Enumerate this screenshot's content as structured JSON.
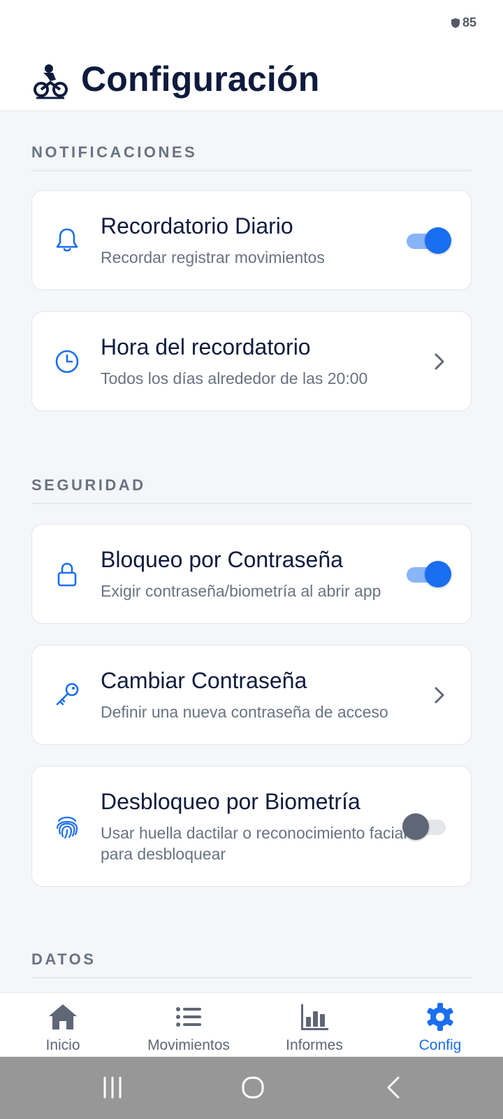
{
  "status_bar": {
    "battery": "85"
  },
  "header": {
    "title": "Configuración",
    "logo_icon": "motorcycle-rider-icon"
  },
  "sections": {
    "notifications": {
      "title": "NOTIFICACIONES",
      "items": [
        {
          "title": "Recordatorio Diario",
          "subtitle": "Recordar registrar movimientos",
          "icon": "bell-icon",
          "toggle": true
        },
        {
          "title": "Hora del recordatorio",
          "subtitle": "Todos los días alrededor de las 20:00",
          "icon": "clock-icon"
        }
      ]
    },
    "security": {
      "title": "SEGURIDAD",
      "items": [
        {
          "title": "Bloqueo por Contraseña",
          "subtitle": "Exigir contraseña/biometría al abrir app",
          "icon": "lock-icon",
          "toggle": true
        },
        {
          "title": "Cambiar Contraseña",
          "subtitle": "Definir una nueva contraseña de acceso",
          "icon": "key-icon"
        },
        {
          "title": "Desbloqueo por Biometría",
          "subtitle": "Usar huella dactilar o reconocimiento facial para desbloquear",
          "icon": "fingerprint-icon",
          "toggle": false
        }
      ]
    },
    "data": {
      "title": "DATOS"
    }
  },
  "bottom_nav": [
    {
      "label": "Inicio",
      "icon": "home-icon"
    },
    {
      "label": "Movimientos",
      "icon": "list-icon"
    },
    {
      "label": "Informes",
      "icon": "bar-chart-icon"
    },
    {
      "label": "Config",
      "icon": "gear-icon",
      "active": true
    }
  ],
  "colors": {
    "accent": "#1a6ef0",
    "text": "#0f1b3d",
    "muted": "#6a7282"
  }
}
